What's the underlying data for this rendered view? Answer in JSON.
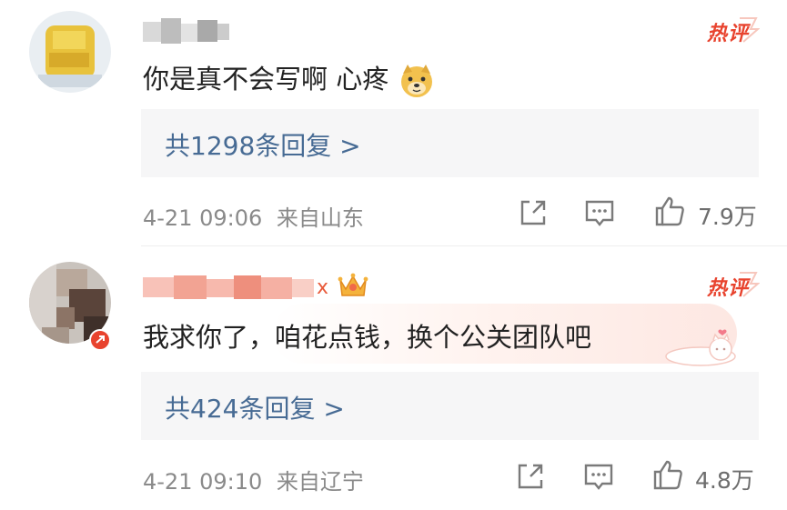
{
  "comments": [
    {
      "text": "你是真不会写啊 心疼",
      "hot_badge": "热评",
      "replies_label": "共1298条回复 >",
      "time": "4-21 09:06",
      "location": "来自山东",
      "likes": "7.9万"
    },
    {
      "text": "我求你了，咱花点钱，换个公关团队吧",
      "hot_badge": "热评",
      "username_suffix": "x",
      "replies_label": "共424条回复 >",
      "time": "4-21 09:10",
      "location": "来自辽宁",
      "likes": "4.8万"
    }
  ],
  "colors": {
    "link": "#476b94",
    "hot": "#e8432e",
    "meta": "#8a8a8a"
  },
  "icons": [
    "share-icon",
    "comment-icon",
    "like-icon",
    "doge-emoji",
    "crown-icon",
    "verified-badge-icon"
  ]
}
